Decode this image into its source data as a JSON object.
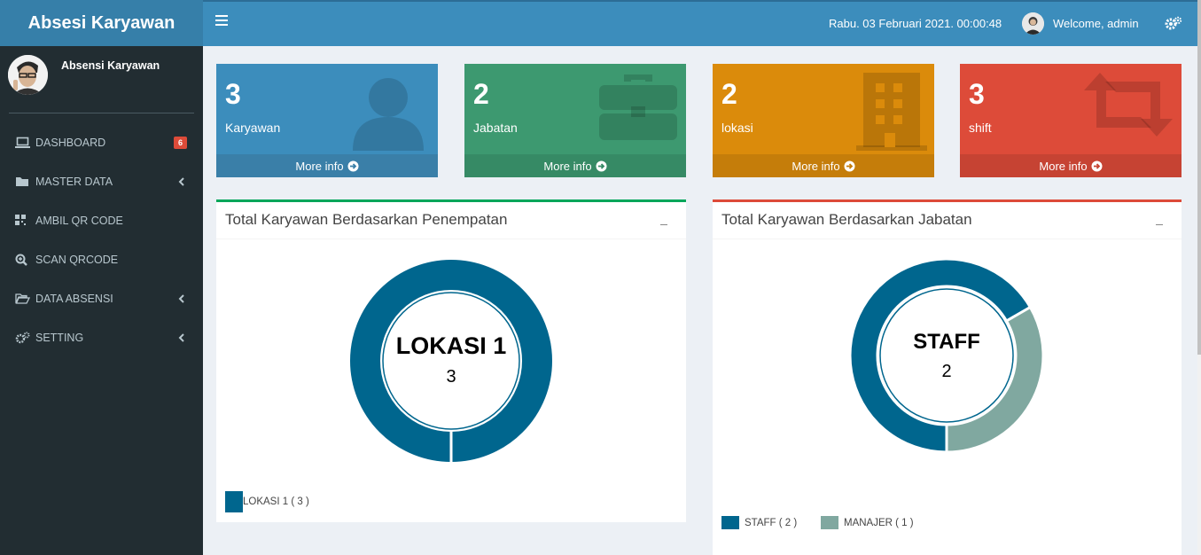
{
  "app": {
    "title": "Absesi Karyawan"
  },
  "header": {
    "datetime": "Rabu. 03 Februari 2021. 00:00:48",
    "welcome": "Welcome, admin"
  },
  "sidebar": {
    "profile_name": "Absensi Karyawan",
    "items": [
      {
        "label": "DASHBOARD",
        "icon": "laptop-icon",
        "badge": "6"
      },
      {
        "label": "MASTER DATA",
        "icon": "folder-icon"
      },
      {
        "label": "AMBIL QR CODE",
        "icon": "qrcode-icon"
      },
      {
        "label": "SCAN QRCODE",
        "icon": "search-plus-icon"
      },
      {
        "label": "DATA ABSENSI",
        "icon": "folder-open-icon"
      },
      {
        "label": "SETTING",
        "icon": "gears-icon"
      }
    ]
  },
  "boxes": [
    {
      "value": "3",
      "label": "Karyawan",
      "more": "More info",
      "color": "#3c8dbc",
      "footer_color": "#3a7fa8",
      "icon": "user-icon"
    },
    {
      "value": "2",
      "label": "Jabatan",
      "more": "More info",
      "color": "#3d9970",
      "footer_color": "#368a65",
      "icon": "briefcase-icon"
    },
    {
      "value": "2",
      "label": "lokasi",
      "more": "More info",
      "color": "#db8b0b",
      "footer_color": "#c57d0a",
      "icon": "building-icon"
    },
    {
      "value": "3",
      "label": "shift",
      "more": "More info",
      "color": "#dd4b39",
      "footer_color": "#c64333",
      "icon": "retweet-icon"
    }
  ],
  "panels": {
    "left": {
      "title": "Total Karyawan Berdasarkan Penempatan",
      "border_color": "#00a65a"
    },
    "right": {
      "title": "Total Karyawan Berdasarkan Jabatan",
      "border_color": "#dd4b39"
    }
  },
  "chart_data": [
    {
      "type": "pie",
      "center_label": "LOKASI 1",
      "center_value": "3",
      "slices": [
        {
          "name": "LOKASI 1",
          "value": 3,
          "color": "#00668e"
        }
      ],
      "legend": [
        "LOKASI 1 ( 3 )"
      ]
    },
    {
      "type": "pie",
      "center_label": "STAFF",
      "center_value": "2",
      "slices": [
        {
          "name": "STAFF",
          "value": 2,
          "color": "#00668e"
        },
        {
          "name": "MANAJER",
          "value": 1,
          "color": "#80a8a0"
        }
      ],
      "legend": [
        "STAFF ( 2 )",
        "MANAJER ( 1 )"
      ]
    }
  ]
}
